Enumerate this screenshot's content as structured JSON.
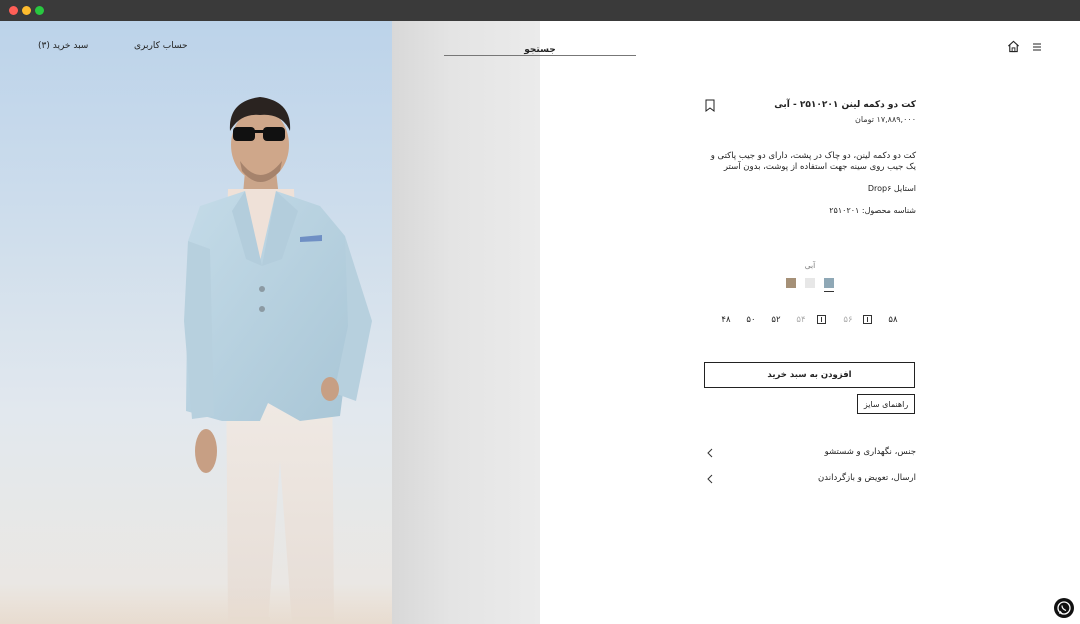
{
  "window": {
    "controls": [
      "close",
      "minimize",
      "maximize"
    ]
  },
  "header": {
    "cart_label": "سبد خرید (۳)",
    "account_label": "حساب کاربری",
    "search_placeholder": "جستجو",
    "icons": [
      "home-icon",
      "menu-icon"
    ]
  },
  "product": {
    "title": "کت دو دکمه لینن ۲۵۱۰۲۰۱ - آبی",
    "price": "۱۷,۸۸۹,۰۰۰ تومان",
    "description": "کت دو دکمه لینن، دو چاک در پشت، دارای دو جیب پاکتی و یک جیب روی سینه جهت استفاده از پوشت، بدون آستر",
    "style": "استایل Drop۶",
    "product_id": "شناسه محصول: ۲۵۱۰۲۰۱",
    "selected_color": "آبی",
    "colors": [
      {
        "name": "blue",
        "hex": "#8fa8b6",
        "selected": true
      },
      {
        "name": "light-gray",
        "hex": "#e7e7e7",
        "selected": false
      },
      {
        "name": "taupe",
        "hex": "#a59077",
        "selected": false
      }
    ],
    "sizes": [
      {
        "label": "۵۸",
        "available": true
      },
      {
        "label": "۵۶",
        "available": false
      },
      {
        "label": "۵۴",
        "available": false
      },
      {
        "label": "۵۲",
        "available": true
      },
      {
        "label": "۵۰",
        "available": true
      },
      {
        "label": "۴۸",
        "available": true
      }
    ],
    "add_to_cart_label": "افزودن به سبد خرید",
    "size_guide_label": "راهنمای سایز",
    "accordions": [
      {
        "label": "جنس، نگهداری و شستشو"
      },
      {
        "label": "ارسال، تعویض و بازگرداندن"
      }
    ]
  }
}
